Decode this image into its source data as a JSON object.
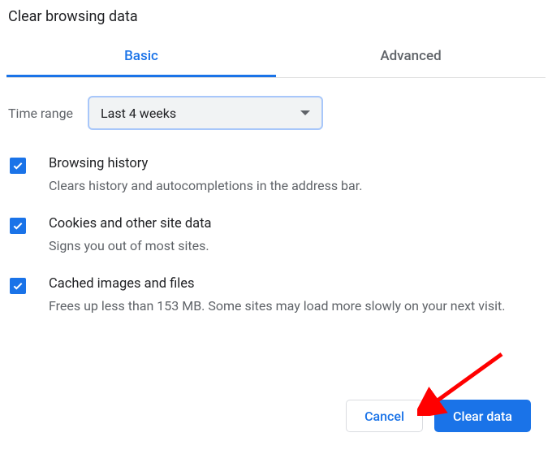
{
  "title": "Clear browsing data",
  "tabs": {
    "basic": "Basic",
    "advanced": "Advanced"
  },
  "time_range": {
    "label": "Time range",
    "value": "Last 4 weeks"
  },
  "options": [
    {
      "checked": true,
      "title": "Browsing history",
      "desc": "Clears history and autocompletions in the address bar."
    },
    {
      "checked": true,
      "title": "Cookies and other site data",
      "desc": "Signs you out of most sites."
    },
    {
      "checked": true,
      "title": "Cached images and files",
      "desc": "Frees up less than 153 MB. Some sites may load more slowly on your next visit."
    }
  ],
  "buttons": {
    "cancel": "Cancel",
    "clear": "Clear data"
  },
  "colors": {
    "accent": "#1a73e8",
    "annotation": "#ff0000"
  }
}
